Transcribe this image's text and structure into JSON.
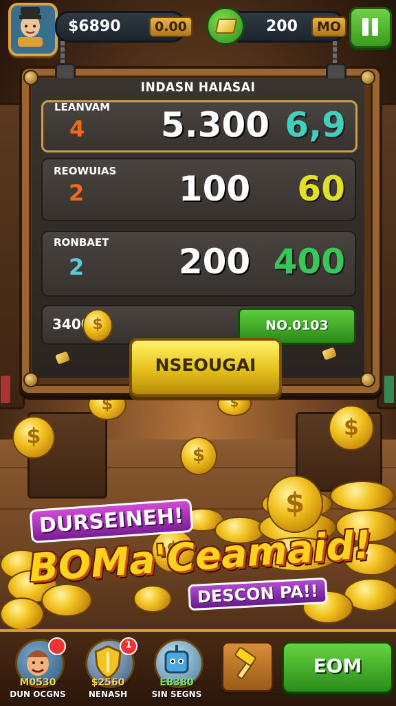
{
  "top_bar": {
    "cash_value": "$6890",
    "cash_tag": "0.00",
    "gems_value": "200",
    "gems_tag": "MO"
  },
  "board": {
    "title": "INDASN HAIASAI",
    "rows": [
      {
        "label": "LEANVAM",
        "level": "4",
        "score": "5.300",
        "bonus": "6,9",
        "level_color": "#f06a1c",
        "bonus_color": "#3fd0c0"
      },
      {
        "label": "REOWUIAS",
        "level": "2",
        "score": "100",
        "bonus": "60",
        "level_color": "#f06a1c",
        "bonus_color": "#e2e024"
      },
      {
        "label": "RONBAET",
        "level": "2",
        "score": "200",
        "bonus": "400",
        "level_color": "#5fc7d8",
        "bonus_color": "#36c85a"
      }
    ],
    "footer_amount": "3400",
    "next_button": "NO.0103",
    "main_button": "NSEOUGAI"
  },
  "banner": {
    "top": "DURSEINEH!",
    "main": "BOMa'Ceamaid!",
    "sub": "DESCON PA!!"
  },
  "bottom_nav": [
    {
      "value": "M0530",
      "label": "DUN OCGNS",
      "icon": "character-icon",
      "badge": ""
    },
    {
      "value": "$2560",
      "label": "NENASH",
      "icon": "shield-icon",
      "badge": "1"
    },
    {
      "value": "EB380",
      "label": "SIN SEGNS",
      "icon": "robot-icon",
      "badge": ""
    }
  ],
  "tool_button_icon": "hammer-icon",
  "go_button": "EOM",
  "colors": {
    "accent_gold": "#f3c322",
    "green": "#3a9a1f",
    "wood": "#9a6530"
  }
}
